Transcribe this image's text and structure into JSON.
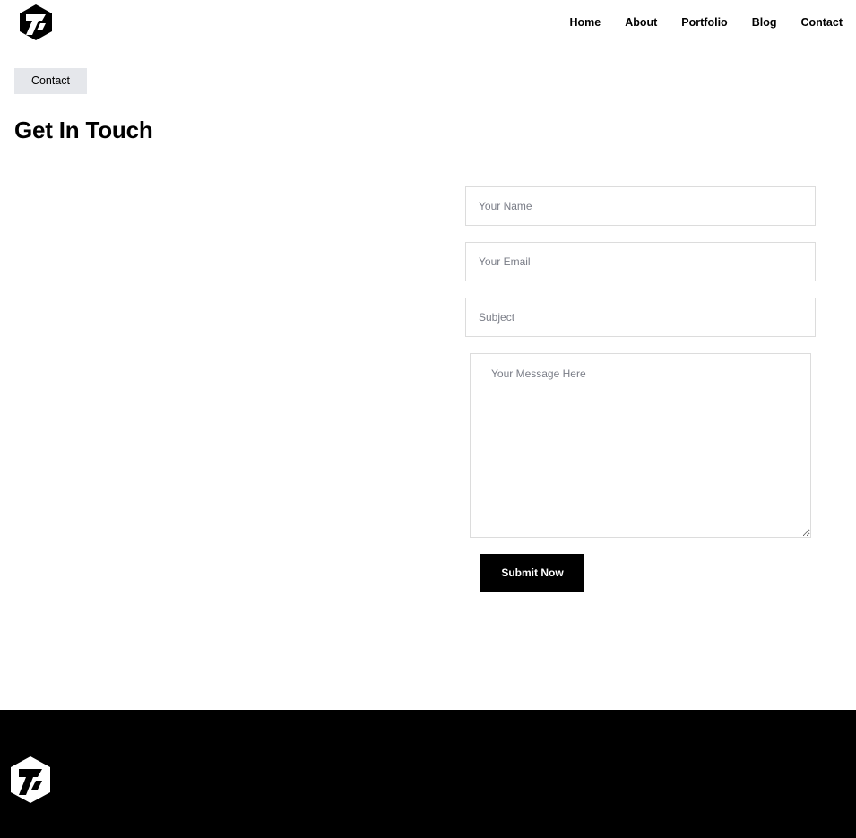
{
  "header": {
    "logo_icon": "hexagon-seven-logo",
    "nav": [
      {
        "label": "Home"
      },
      {
        "label": "About"
      },
      {
        "label": "Portfolio"
      },
      {
        "label": "Blog"
      },
      {
        "label": "Contact"
      }
    ]
  },
  "breadcrumb": {
    "label": "Contact"
  },
  "page": {
    "title": "Get In Touch"
  },
  "form": {
    "name_placeholder": "Your Name",
    "email_placeholder": "Your Email",
    "subject_placeholder": "Subject",
    "message_placeholder": "Your Message Here",
    "submit_label": "Submit Now"
  },
  "footer": {
    "logo_icon": "hexagon-seven-logo"
  },
  "colors": {
    "background": "#ffffff",
    "text": "#000000",
    "breadcrumb_bg": "#e5e7eb",
    "button_bg": "#000000",
    "footer_bg": "#000000"
  }
}
